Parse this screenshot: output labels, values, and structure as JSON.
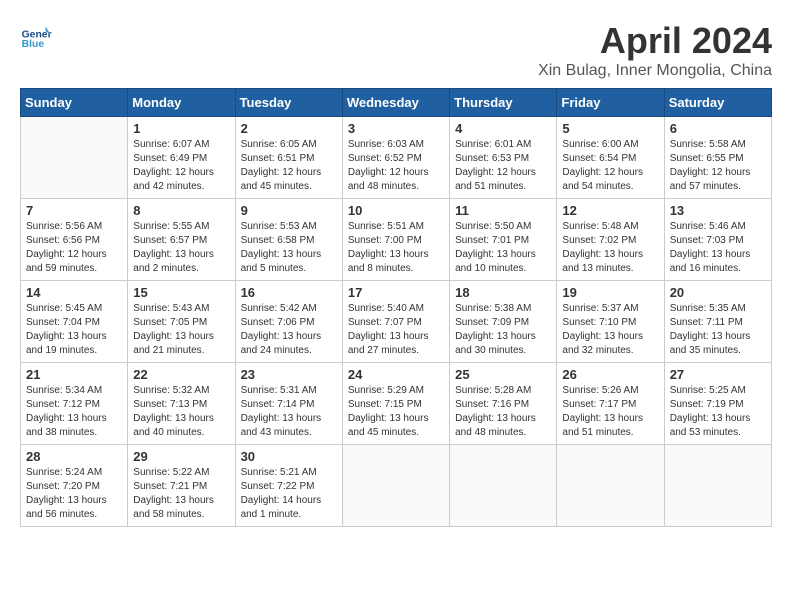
{
  "header": {
    "logo_general": "General",
    "logo_blue": "Blue",
    "title": "April 2024",
    "subtitle": "Xin Bulag, Inner Mongolia, China"
  },
  "weekdays": [
    "Sunday",
    "Monday",
    "Tuesday",
    "Wednesday",
    "Thursday",
    "Friday",
    "Saturday"
  ],
  "weeks": [
    [
      {
        "day": "",
        "info": ""
      },
      {
        "day": "1",
        "info": "Sunrise: 6:07 AM\nSunset: 6:49 PM\nDaylight: 12 hours\nand 42 minutes."
      },
      {
        "day": "2",
        "info": "Sunrise: 6:05 AM\nSunset: 6:51 PM\nDaylight: 12 hours\nand 45 minutes."
      },
      {
        "day": "3",
        "info": "Sunrise: 6:03 AM\nSunset: 6:52 PM\nDaylight: 12 hours\nand 48 minutes."
      },
      {
        "day": "4",
        "info": "Sunrise: 6:01 AM\nSunset: 6:53 PM\nDaylight: 12 hours\nand 51 minutes."
      },
      {
        "day": "5",
        "info": "Sunrise: 6:00 AM\nSunset: 6:54 PM\nDaylight: 12 hours\nand 54 minutes."
      },
      {
        "day": "6",
        "info": "Sunrise: 5:58 AM\nSunset: 6:55 PM\nDaylight: 12 hours\nand 57 minutes."
      }
    ],
    [
      {
        "day": "7",
        "info": "Sunrise: 5:56 AM\nSunset: 6:56 PM\nDaylight: 12 hours\nand 59 minutes."
      },
      {
        "day": "8",
        "info": "Sunrise: 5:55 AM\nSunset: 6:57 PM\nDaylight: 13 hours\nand 2 minutes."
      },
      {
        "day": "9",
        "info": "Sunrise: 5:53 AM\nSunset: 6:58 PM\nDaylight: 13 hours\nand 5 minutes."
      },
      {
        "day": "10",
        "info": "Sunrise: 5:51 AM\nSunset: 7:00 PM\nDaylight: 13 hours\nand 8 minutes."
      },
      {
        "day": "11",
        "info": "Sunrise: 5:50 AM\nSunset: 7:01 PM\nDaylight: 13 hours\nand 10 minutes."
      },
      {
        "day": "12",
        "info": "Sunrise: 5:48 AM\nSunset: 7:02 PM\nDaylight: 13 hours\nand 13 minutes."
      },
      {
        "day": "13",
        "info": "Sunrise: 5:46 AM\nSunset: 7:03 PM\nDaylight: 13 hours\nand 16 minutes."
      }
    ],
    [
      {
        "day": "14",
        "info": "Sunrise: 5:45 AM\nSunset: 7:04 PM\nDaylight: 13 hours\nand 19 minutes."
      },
      {
        "day": "15",
        "info": "Sunrise: 5:43 AM\nSunset: 7:05 PM\nDaylight: 13 hours\nand 21 minutes."
      },
      {
        "day": "16",
        "info": "Sunrise: 5:42 AM\nSunset: 7:06 PM\nDaylight: 13 hours\nand 24 minutes."
      },
      {
        "day": "17",
        "info": "Sunrise: 5:40 AM\nSunset: 7:07 PM\nDaylight: 13 hours\nand 27 minutes."
      },
      {
        "day": "18",
        "info": "Sunrise: 5:38 AM\nSunset: 7:09 PM\nDaylight: 13 hours\nand 30 minutes."
      },
      {
        "day": "19",
        "info": "Sunrise: 5:37 AM\nSunset: 7:10 PM\nDaylight: 13 hours\nand 32 minutes."
      },
      {
        "day": "20",
        "info": "Sunrise: 5:35 AM\nSunset: 7:11 PM\nDaylight: 13 hours\nand 35 minutes."
      }
    ],
    [
      {
        "day": "21",
        "info": "Sunrise: 5:34 AM\nSunset: 7:12 PM\nDaylight: 13 hours\nand 38 minutes."
      },
      {
        "day": "22",
        "info": "Sunrise: 5:32 AM\nSunset: 7:13 PM\nDaylight: 13 hours\nand 40 minutes."
      },
      {
        "day": "23",
        "info": "Sunrise: 5:31 AM\nSunset: 7:14 PM\nDaylight: 13 hours\nand 43 minutes."
      },
      {
        "day": "24",
        "info": "Sunrise: 5:29 AM\nSunset: 7:15 PM\nDaylight: 13 hours\nand 45 minutes."
      },
      {
        "day": "25",
        "info": "Sunrise: 5:28 AM\nSunset: 7:16 PM\nDaylight: 13 hours\nand 48 minutes."
      },
      {
        "day": "26",
        "info": "Sunrise: 5:26 AM\nSunset: 7:17 PM\nDaylight: 13 hours\nand 51 minutes."
      },
      {
        "day": "27",
        "info": "Sunrise: 5:25 AM\nSunset: 7:19 PM\nDaylight: 13 hours\nand 53 minutes."
      }
    ],
    [
      {
        "day": "28",
        "info": "Sunrise: 5:24 AM\nSunset: 7:20 PM\nDaylight: 13 hours\nand 56 minutes."
      },
      {
        "day": "29",
        "info": "Sunrise: 5:22 AM\nSunset: 7:21 PM\nDaylight: 13 hours\nand 58 minutes."
      },
      {
        "day": "30",
        "info": "Sunrise: 5:21 AM\nSunset: 7:22 PM\nDaylight: 14 hours\nand 1 minute."
      },
      {
        "day": "",
        "info": ""
      },
      {
        "day": "",
        "info": ""
      },
      {
        "day": "",
        "info": ""
      },
      {
        "day": "",
        "info": ""
      }
    ]
  ]
}
